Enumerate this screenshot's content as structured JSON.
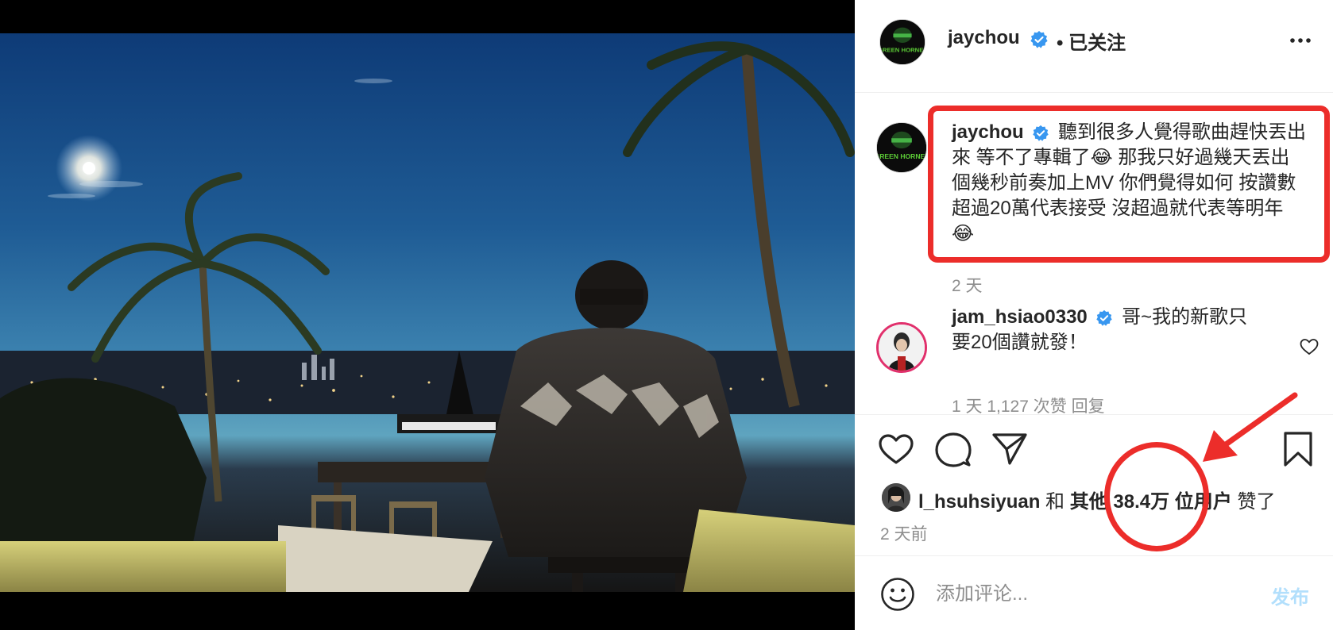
{
  "header": {
    "username": "jaychou",
    "follow_status": "• 已关注",
    "avatar_text": "GREEN HORNET"
  },
  "caption": {
    "username": "jaychou",
    "text": "聽到很多人覺得歌曲趕快丟出來 等不了專輯了😂  那我只好過幾天丟出個幾秒前奏加上MV 你們覺得如何 按讚數超過20萬代表接受 沒超過就代表等明年😂",
    "lines": [
      "聽到很多人覺得歌曲趕快丟出",
      "來 等不了專輯了😂  那我只好過幾天丟出",
      "個幾秒前奏加上MV 你們覺得如何 按讚數",
      "超過20萬代表接受 沒超過就代表等明年",
      "😂"
    ],
    "time": "2 天"
  },
  "comments": [
    {
      "username": "jam_hsiao0330",
      "lines": [
        "哥~我的新歌只",
        "要20個讚就發！"
      ],
      "meta": "1 天   1,127 次赞   回复"
    }
  ],
  "likes": {
    "user": "l_hsuhsiyuan",
    "connector": " 和 ",
    "others_prefix": "其他 ",
    "count": "38.4万",
    "others_suffix": " 位用户",
    "verb": " 赞了"
  },
  "post_time": "2 天前",
  "comment_input": {
    "placeholder": "添加评论...",
    "post_label": "发布"
  },
  "colors": {
    "annotation": "#ec2d2a",
    "verified": "#3897f0",
    "post_disabled": "#b2dffc",
    "muted": "#8e8e8e"
  }
}
